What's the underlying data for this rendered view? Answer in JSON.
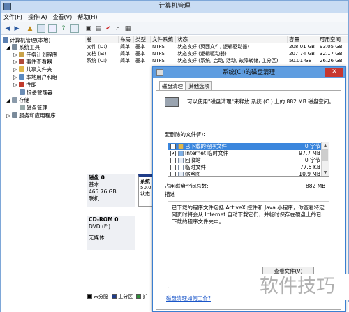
{
  "window": {
    "title": "计算机管理"
  },
  "menu": [
    "文件(F)",
    "操作(A)",
    "查看(V)",
    "帮助(H)"
  ],
  "tree": {
    "root": "计算机管理(本地)",
    "system_tools": "系统工具",
    "task_scheduler": "任务计划程序",
    "event_viewer": "事件查看器",
    "shared_folders": "共享文件夹",
    "local_users": "本地用户和组",
    "performance": "性能",
    "device_manager": "设备管理器",
    "storage": "存储",
    "disk_management": "磁盘管理",
    "services_apps": "服务和应用程序"
  },
  "volume_list": {
    "headers": [
      "卷",
      "布局",
      "类型",
      "文件系统",
      "状态",
      "容量",
      "可用空间"
    ],
    "rows": [
      [
        "文件 (D:)",
        "简单",
        "基本",
        "NTFS",
        "状态良好 (页面文件, 逻辑驱动器)",
        "208.01 GB",
        "93.05 GB"
      ],
      [
        "文档 (E:)",
        "简单",
        "基本",
        "NTFS",
        "状态良好 (逻辑驱动器)",
        "207.74 GB",
        "32.17 GB"
      ],
      [
        "系统 (C:)",
        "简单",
        "基本",
        "NTFS",
        "状态良好 (系统, 启动, 活动, 故障转储, 主分区)",
        "50.01 GB",
        "26.26 GB"
      ]
    ]
  },
  "disks": {
    "disk0_name": "磁盘 0",
    "disk0_type": "基本",
    "disk0_size": "465.76 GB",
    "disk0_status": "联机",
    "disk0_part_name": "系统",
    "disk0_part_size": "50.0",
    "disk0_part_status": "状态",
    "cdrom_name": "CD-ROM 0",
    "cdrom_drive": "DVD (F:)",
    "cdrom_status": "无媒体"
  },
  "legend": [
    "未分配",
    "主分区",
    "扩"
  ],
  "colors": {
    "unallocated": "#000000",
    "primary": "#1f3c88",
    "extended": "#2f8f3a"
  },
  "dialog": {
    "title": "系统(C:)的磁盘清理",
    "tab_cleanup": "磁盘清理",
    "tab_more": "其他选项",
    "intro": "可以使用\"磁盘清理\"来释放 系统 (C:) 上的 882 MB 磁盘空间。",
    "files_label": "要删除的文件(F):",
    "files": [
      {
        "name": "已下载的程序文件",
        "size": "0 字节",
        "checked": true,
        "selected": true
      },
      {
        "name": "Internet 临时文件",
        "size": "97.7 MB",
        "checked": true,
        "selected": false
      },
      {
        "name": "回收站",
        "size": "0 字节",
        "checked": false,
        "selected": false
      },
      {
        "name": "临时文件",
        "size": "77.5 KB",
        "checked": false,
        "selected": false
      },
      {
        "name": "缩略图",
        "size": "10.9 MB",
        "checked": false,
        "selected": false
      }
    ],
    "total_label": "占用磁盘空间总数:",
    "total_value": "882 MB",
    "desc_title": "描述",
    "desc_text": "已下载的程序文件包括 ActiveX 控件和 Java 小程序，你查看特定网页时将会从 Internet 自动下载它们，并临时保存在硬盘上的已下载的程序文件夹中。",
    "view_files": "查看文件(V)",
    "how_link": "磁盘清理如何工作?",
    "close": "✕"
  },
  "watermark": "软件技巧"
}
